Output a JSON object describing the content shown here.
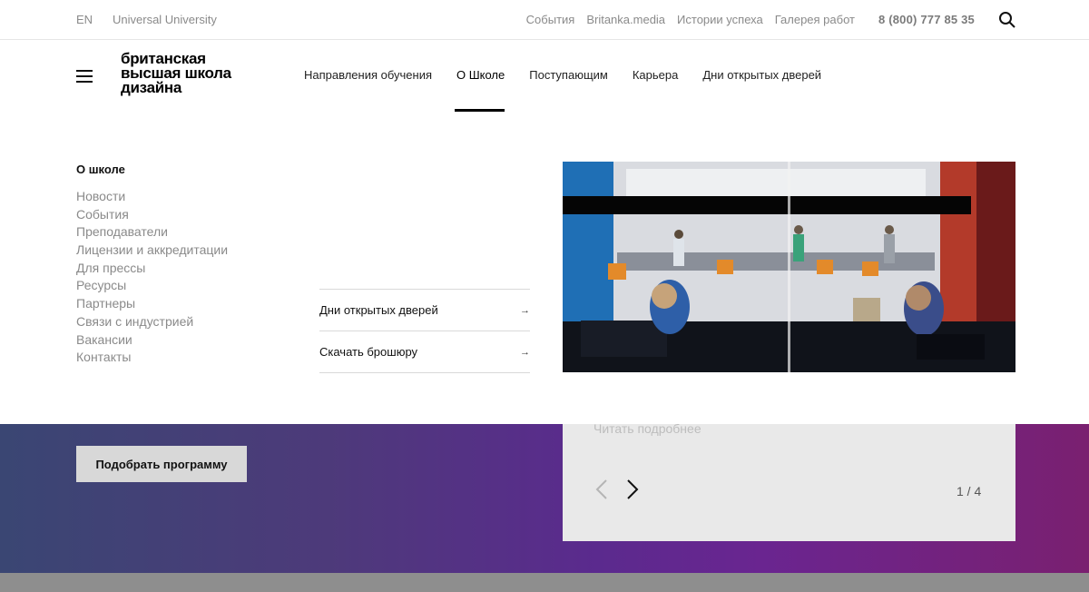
{
  "topbar": {
    "lang": "EN",
    "university": "Universal University",
    "links": [
      "События",
      "Britanka.media",
      "Истории успеха",
      "Галерея работ"
    ],
    "phone": "8 (800) 777 85 35",
    "search_icon": "search-icon"
  },
  "header": {
    "logo_lines": [
      "британская",
      "высшая школа",
      "дизайна"
    ],
    "nav": [
      "Направления обучения",
      "О Школе",
      "Поступающим",
      "Карьера",
      "Дни открытых дверей"
    ],
    "active_nav": "О Школе"
  },
  "mega_menu": {
    "title": "О школе",
    "items": [
      "Новости",
      "События",
      "Преподаватели",
      "Лицензии и аккредитации",
      "Для прессы",
      "Ресурсы",
      "Партнеры",
      "Связи с индустрией",
      "Вакансии",
      "Контакты"
    ],
    "actions": [
      {
        "label": "Дни открытых дверей",
        "icon": "arrow-right-icon"
      },
      {
        "label": "Скачать брошюру",
        "icon": "arrow-right-icon"
      }
    ]
  },
  "hero": {
    "button_label": "Подобрать программу",
    "card_link": "Читать подробнее",
    "pager": "1 / 4"
  },
  "colors": {
    "accent_text": "#111111",
    "muted_text": "#8a8a8a",
    "hero_gradient_start": "#3a4673",
    "hero_gradient_end": "#7a2070"
  }
}
